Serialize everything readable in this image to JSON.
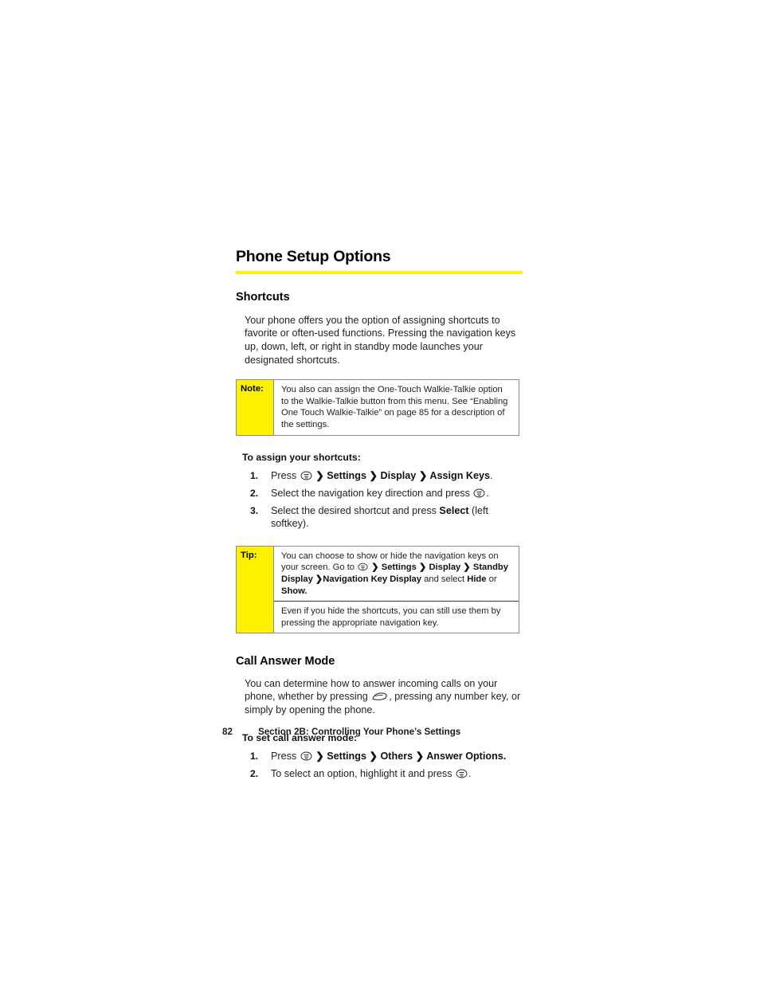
{
  "page": {
    "title": "Phone Setup Options",
    "accent_color": "#fff200",
    "border_color": "#8c8c8c"
  },
  "sections": [
    {
      "heading": "Shortcuts",
      "paragraph": "Your phone offers you the option of assigning shortcuts to favorite or often-used functions. Pressing the navigation keys up, down, left, or right in standby mode launches your designated shortcuts.",
      "lead_in": "To assign your shortcuts:"
    },
    {
      "heading": "Call Answer Mode",
      "paragraph_part1": "You can determine how to answer incoming calls on your phone, whether by pressing ",
      "paragraph_part2": ", pressing any number key, or simply by opening the phone.",
      "lead_in": "To set call answer mode:"
    }
  ],
  "note_box": {
    "label": "Note:",
    "text": "You also can assign the One-Touch Walkie-Talkie option to the Walkie-Talkie button from this menu. See “Enabling One Touch Walkie-Talkie” on page 85 for a description of the settings."
  },
  "tip_box": {
    "label": "Tip:",
    "para1_a": "You can choose to show or hide the navigation keys on your screen. Go to ",
    "para1_chevron1": "❯",
    "para1_settings": "Settings",
    "para1_chevron2": "❯",
    "para1_display": "Display",
    "para1_chevron3": "❯",
    "para1_standby": "Standby Display",
    "para1_chevron4": "❯",
    "para1_navkey": "Navigation Key Display",
    "para1_mid": " and select ",
    "para1_hide": "Hide",
    "para1_or": " or ",
    "para1_show": "Show.",
    "para2": "Even if you hide the shortcuts, you can still use them by pressing the appropriate navigation key."
  },
  "shortcut_steps": [
    {
      "num": "1.",
      "press_label": "Press ",
      "icon": "menu-key-icon",
      "chevron1": "❯ ",
      "menu1": "Settings",
      "chevron2": " ❯ ",
      "menu2": "Display",
      "chevron3": " ❯ ",
      "menu3": "Assign Keys",
      "trailing": "."
    },
    {
      "num": "2.",
      "text_before": "Select the navigation key direction and press ",
      "icon": "menu-key-icon",
      "trailing": "."
    },
    {
      "num": "3.",
      "text_before": "Select the desired shortcut and press ",
      "bold_word": "Select",
      "trailing": " (left softkey)."
    }
  ],
  "answer_steps": [
    {
      "num": "1.",
      "press_label": "Press ",
      "icon": "menu-key-icon",
      "chevron1": "❯ ",
      "menu1": "Settings",
      "chevron2": " ❯ ",
      "menu2": "Others",
      "chevron3": " ❯ ",
      "menu3": "Answer Options.",
      "trailing": ""
    },
    {
      "num": "2.",
      "text_before": "To select an option, highlight it and press ",
      "icon": "menu-key-icon",
      "trailing": "."
    }
  ],
  "footer": {
    "page_number": "82",
    "section_label": "Section 2B: Controlling Your Phone’s Settings"
  }
}
